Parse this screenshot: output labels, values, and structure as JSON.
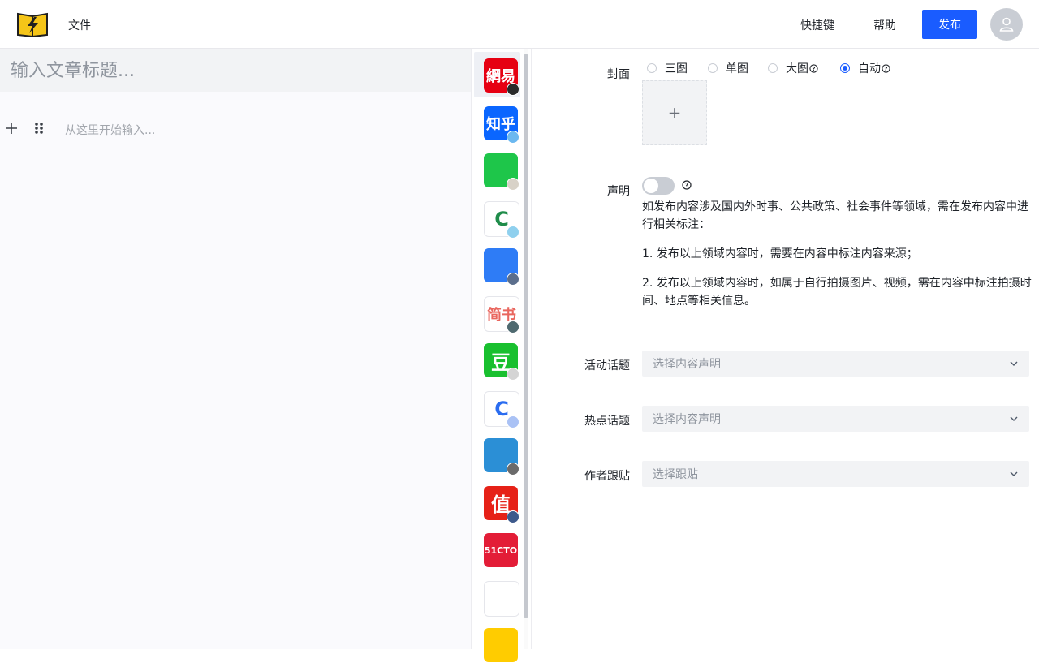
{
  "header": {
    "menu_file": "文件",
    "shortcuts": "快捷键",
    "help": "帮助",
    "publish": "发布"
  },
  "editor": {
    "title_placeholder": "输入文章标题...",
    "body_placeholder": "从这里开始输入..."
  },
  "platforms": [
    {
      "name": "网易",
      "text": "網易",
      "color": "#e60012",
      "fg": "#ffffff",
      "badge": "#2a2a2a",
      "active": true
    },
    {
      "name": "知乎",
      "text": "知乎",
      "color": "#0a66ff",
      "fg": "#ffffff",
      "badge": "#6bb8f0",
      "active": false
    },
    {
      "name": "platform-3",
      "text": "",
      "color": "#1ec64a",
      "fg": "#ffffff",
      "badge": "#d8d2c8",
      "active": false
    },
    {
      "name": "platform-4",
      "text": "C",
      "color": "#ffffff",
      "fg": "#1f8c4a",
      "badge": "#8fd0ee",
      "active": false
    },
    {
      "name": "platform-5",
      "text": "",
      "color": "#2e7cf6",
      "fg": "#ffffff",
      "badge": "#5b6e8c",
      "active": false
    },
    {
      "name": "简书",
      "text": "简书",
      "color": "#ffffff",
      "fg": "#e9665e",
      "badge": "#4f6a70",
      "active": false
    },
    {
      "name": "豆",
      "text": "豆",
      "color": "#19c02f",
      "fg": "#ffffff",
      "badge": "#d4d4d4",
      "active": false
    },
    {
      "name": "platform-8",
      "text": "C",
      "color": "#ffffff",
      "fg": "#2a6cf0",
      "badge": "#aac2f5",
      "active": false
    },
    {
      "name": "platform-9",
      "text": "",
      "color": "#2b8fd6",
      "fg": "#ffffff",
      "badge": "#6b6b6b",
      "active": false
    },
    {
      "name": "值",
      "text": "值",
      "color": "#e62117",
      "fg": "#ffffff",
      "badge": "#3d5a8c",
      "active": false
    },
    {
      "name": "51CTO",
      "text": "51CTO",
      "color": "#e31d37",
      "fg": "#ffffff",
      "badge": "",
      "active": false
    },
    {
      "name": "platform-12",
      "text": "",
      "color": "#ffffff",
      "fg": "#1ec07a",
      "badge": "",
      "active": false
    },
    {
      "name": "platform-13",
      "text": "",
      "color": "#ffcc00",
      "fg": "#000000",
      "badge": "",
      "active": false
    }
  ],
  "form": {
    "cover": {
      "label": "封面",
      "options": [
        "三图",
        "单图",
        "大图",
        "自动"
      ],
      "selected": "自动",
      "upload_glyph": "+"
    },
    "declaration": {
      "label": "声明",
      "enabled": false,
      "line1": "如发布内容涉及国内外时事、公共政策、社会事件等领域，需在发布内容中进行相关标注：",
      "line2": "1. 发布以上领域内容时，需要在内容中标注内容来源；",
      "line3": "2. 发布以上领域内容时，如属于自行拍摄图片、视频，需在内容中标注拍摄时间、地点等相关信息。"
    },
    "activity_topic": {
      "label": "活动话题",
      "placeholder": "选择内容声明"
    },
    "hot_topic": {
      "label": "热点话题",
      "placeholder": "选择内容声明"
    },
    "author_follow": {
      "label": "作者跟贴",
      "placeholder": "选择跟贴"
    }
  },
  "colors": {
    "accent": "#1a5cff",
    "input_bg": "#f2f3f5",
    "placeholder": "#8f959e"
  }
}
